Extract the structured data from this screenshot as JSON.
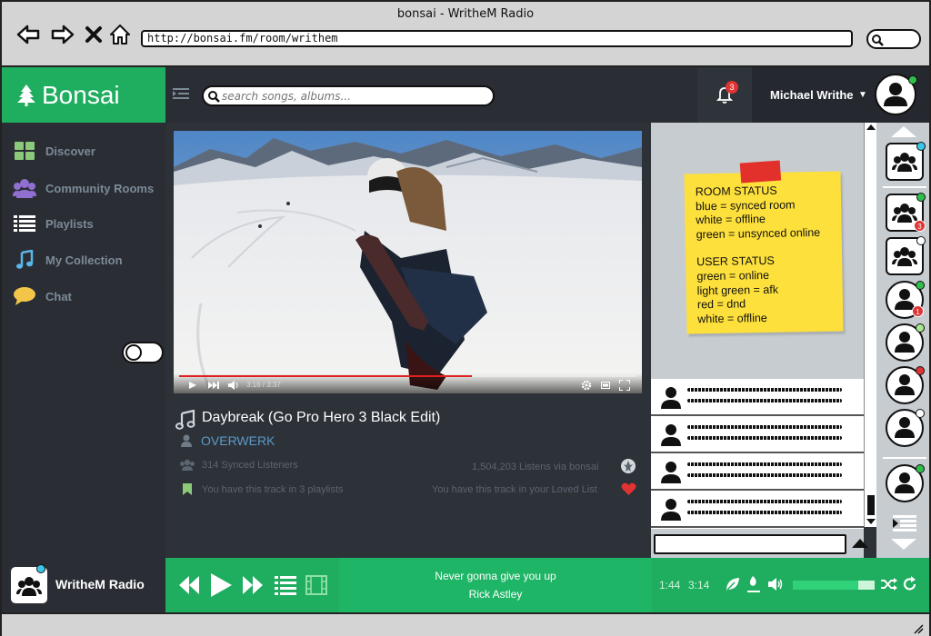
{
  "window": {
    "title": "bonsai - WritheM Radio"
  },
  "browser": {
    "url": "http://bonsai.fm/room/writhem"
  },
  "app": {
    "logo": "Bonsai"
  },
  "search": {
    "placeholder": "search songs, albums..."
  },
  "notifications": {
    "count": "3"
  },
  "user": {
    "name": "Michael Writhe"
  },
  "sidebar": {
    "items": [
      {
        "label": "Discover",
        "icon": "grid-icon"
      },
      {
        "label": "Community Rooms",
        "icon": "people-icon"
      },
      {
        "label": "Playlists",
        "icon": "list-icon"
      },
      {
        "label": "My Collection",
        "icon": "music-note-icon"
      },
      {
        "label": "Chat",
        "icon": "speech-bubble-icon"
      }
    ]
  },
  "video": {
    "time": "3:16 / 3:37",
    "progress": 0.64
  },
  "track": {
    "title": "Daybreak (Go Pro Hero 3 Black Edit)",
    "artist": "OVERWERK",
    "synced": "314 Synced Listeners",
    "listens": "1,504,203 Listens via bonsai",
    "playlists": "You have this track in 3 playlists",
    "loved": "You have this track in your Loved List"
  },
  "note": {
    "room_title": "ROOM STATUS",
    "room_lines": [
      "blue = synced room",
      "white = offline",
      "green = unsynced online"
    ],
    "user_title": "USER STATUS",
    "user_lines": [
      "green = online",
      "light green = afk",
      "red = dnd",
      "white = offline"
    ]
  },
  "colors": {
    "brand": "#1fad5f",
    "synced_room": "#3ac8e8",
    "online": "#2fbf4a",
    "afk": "#a8e890",
    "dnd": "#e03434",
    "offline": "#ffffff"
  },
  "roster": {
    "rooms": [
      {
        "status": "blue",
        "badge": ""
      },
      {
        "status": "green",
        "badge": "3"
      },
      {
        "status": "white",
        "badge": ""
      }
    ],
    "users": [
      {
        "status": "green",
        "badge": "1"
      },
      {
        "status": "light green",
        "badge": ""
      },
      {
        "status": "red",
        "badge": ""
      },
      {
        "status": "white",
        "badge": ""
      },
      {
        "status": "green",
        "badge": ""
      }
    ]
  },
  "footer": {
    "room_name": "WritheM Radio",
    "now_playing_title": "Never gonna give you up",
    "now_playing_artist": "Rick Astley",
    "elapsed": "1:44",
    "duration": "3:14",
    "volume": 0.8
  }
}
